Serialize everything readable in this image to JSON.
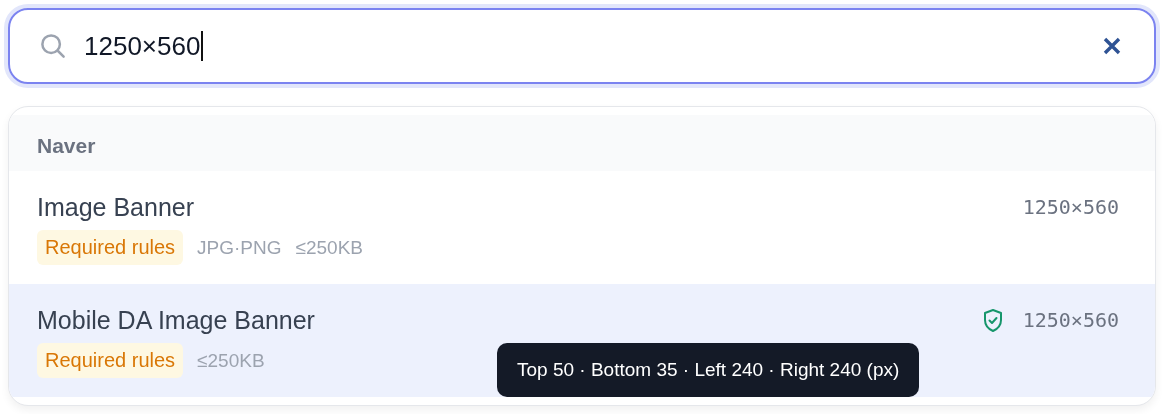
{
  "search": {
    "value": "1250×560"
  },
  "results": {
    "group": "Naver",
    "items": [
      {
        "name": "Image Banner",
        "tag": "Required rules",
        "specs": [
          "JPG·PNG",
          "≤250KB"
        ],
        "size": "1250×560",
        "shield": false,
        "selected": false
      },
      {
        "name": "Mobile DA Image Banner",
        "tag": "Required rules",
        "specs": [
          "≤250KB"
        ],
        "size": "1250×560",
        "shield": true,
        "selected": true
      }
    ]
  },
  "tooltip": "Top 50 · Bottom 35 · Left 240 · Right 240 (px)"
}
